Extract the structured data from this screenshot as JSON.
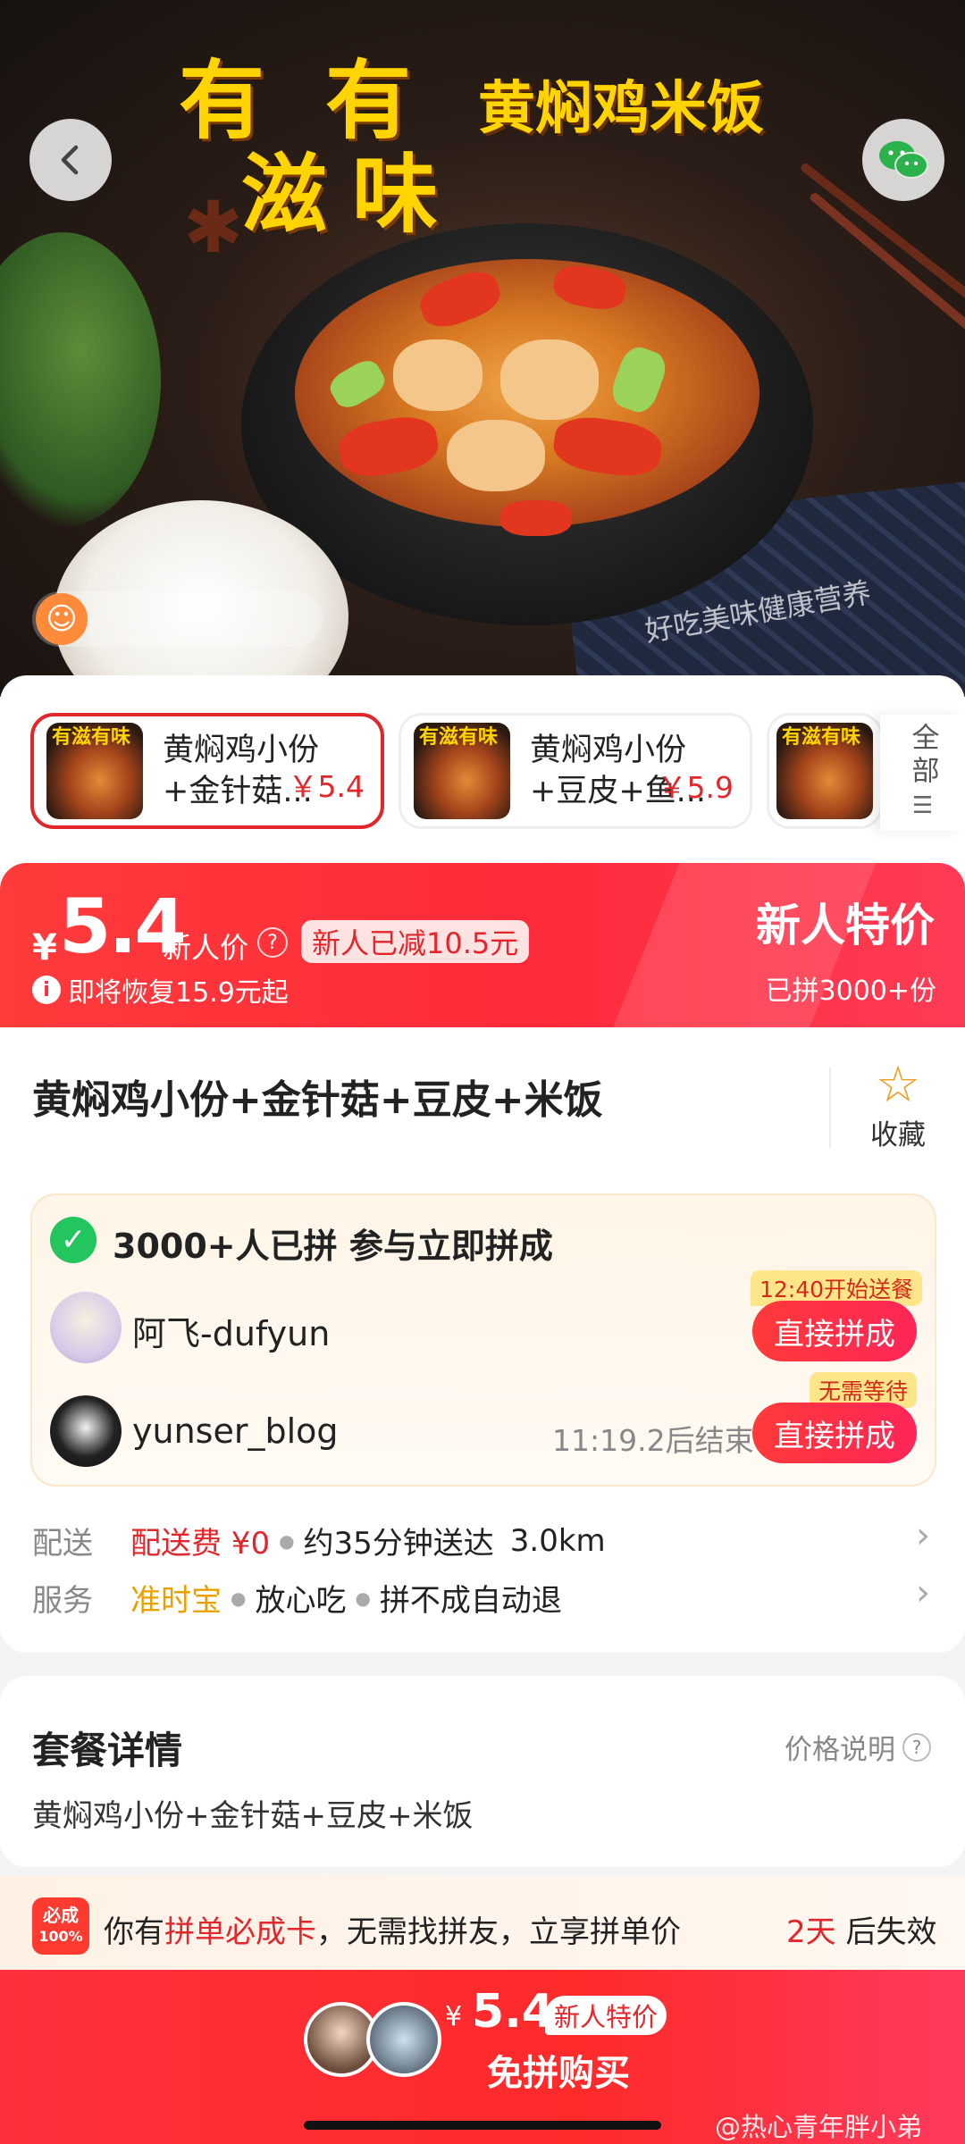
{
  "hero": {
    "title_line1": "有",
    "title_line1b": "有",
    "title_line2": "滋",
    "title_line2b": "味",
    "subtitle": "黄焖鸡米饭",
    "caption": "好吃美味健康营养"
  },
  "header": {
    "back_icon": "chevron-left-icon",
    "share_icon": "wechat-icon"
  },
  "skus": [
    {
      "name": "黄焖鸡小份+金针菇...",
      "price": "￥5.4",
      "thumb_text": "有滋有味"
    },
    {
      "name": "黄焖鸡小份+豆皮+鱼...",
      "price": "￥5.9",
      "thumb_text": "有滋有味"
    },
    {
      "thumb_text": "有滋有味"
    }
  ],
  "sku_all_label": "全部",
  "price_banner": {
    "currency": "¥",
    "price": "5.4",
    "price_label": "新人价",
    "discount_tag": "新人已减10.5元",
    "restore_note": "即将恢复15.9元起",
    "special_label": "新人特价",
    "sold": "已拼3000+份"
  },
  "product": {
    "title": "黄焖鸡小份+金针菇+豆皮+米饭",
    "favorite_label": "收藏"
  },
  "group": {
    "headline": "3000+人已拼 参与立即拼成",
    "members": [
      {
        "name": "阿飞-dufyun",
        "badge": "12:40开始送餐",
        "button": "直接拼成",
        "timer": ""
      },
      {
        "name": "yunser_blog",
        "badge": "无需等待",
        "button": "直接拼成",
        "timer": "11:19.2后结束"
      }
    ]
  },
  "delivery": {
    "label": "配送",
    "fee": "配送费 ¥0",
    "time": "约35分钟送达",
    "distance": "3.0km"
  },
  "service": {
    "label": "服务",
    "items": [
      "准时宝",
      "放心吃",
      "拼不成自动退"
    ],
    "accent": "#e8a100"
  },
  "package": {
    "title": "套餐详情",
    "price_note": "价格说明",
    "items": "黄焖鸡小份+金针菇+豆皮+米饭"
  },
  "promo": {
    "badge_top": "必成",
    "badge_bottom": "100%",
    "text_prefix": "你有",
    "text_highlight": "拼单必成卡",
    "text_suffix": "，无需找拼友，立享拼单价",
    "expire_days": "2天",
    "expire_suffix": " 后失效"
  },
  "buy_bar": {
    "currency": "¥",
    "price": "5.4",
    "tag": "新人特价",
    "label": "免拼购买"
  },
  "watermark": "@热心青年胖小弟",
  "colors": {
    "accent_red": "#e3262b",
    "brand_gradient_start": "#ff2f3d",
    "gold": "#ffd400"
  }
}
